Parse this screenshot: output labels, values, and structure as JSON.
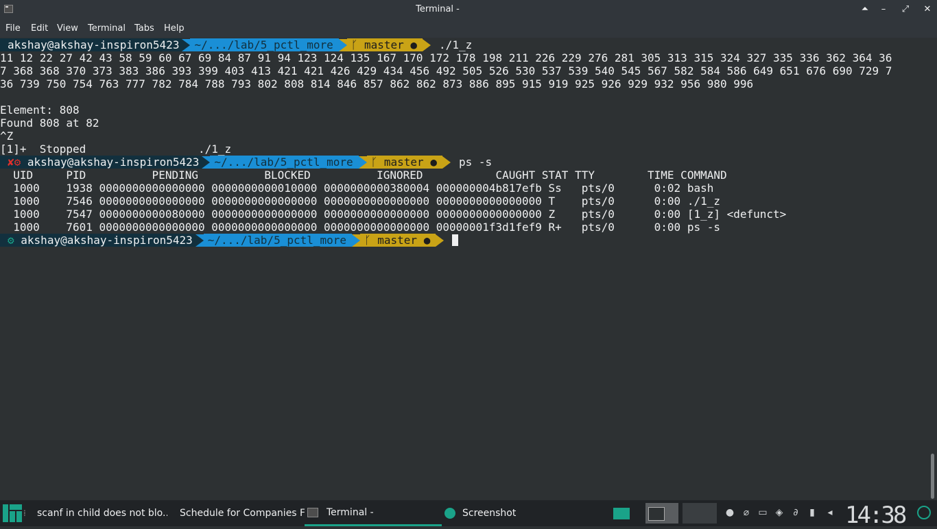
{
  "window": {
    "title": "Terminal -",
    "controls": [
      "⏶",
      "–",
      "⤢",
      "✕"
    ]
  },
  "menu": [
    "File",
    "Edit",
    "View",
    "Terminal",
    "Tabs",
    "Help"
  ],
  "prompt": {
    "user": "akshay@akshay-inspiron5423",
    "path": "~/.../lab/5_pctl_more",
    "git": "master ●",
    "git_icon": "git-branch-icon"
  },
  "lines": {
    "cmd1": "./1_z",
    "out1": "11 12 22 27 42 43 58 59 60 67 69 84 87 91 94 123 124 135 167 170 172 178 198 211 226 229 276 281 305 313 315 324 327 335 336 362 364 36",
    "out2": "7 368 368 370 373 383 386 393 399 403 413 421 421 426 429 434 456 492 505 526 530 537 539 540 545 567 582 584 586 649 651 676 690 729 7",
    "out3": "36 739 750 754 763 777 782 784 788 793 802 808 814 846 857 862 862 873 886 895 915 919 925 926 929 932 956 980 996",
    "element": "Element: 808",
    "found": "Found 808 at 82",
    "ctrlz": "^Z",
    "stopped": "[1]+  Stopped                 ./1_z",
    "cmd2": "ps -s",
    "status_fail": "✘⚙",
    "status_ok": "⚙"
  },
  "ps_header": "  UID     PID          PENDING          BLOCKED          IGNORED           CAUGHT STAT TTY        TIME COMMAND",
  "ps_rows": [
    "  1000    1938 0000000000000000 0000000000010000 0000000000380004 000000004b817efb Ss   pts/0      0:02 bash",
    "  1000    7546 0000000000000000 0000000000000000 0000000000000000 0000000000000000 T    pts/0      0:00 ./1_z",
    "  1000    7547 0000000000080000 0000000000000000 0000000000000000 0000000000000000 Z    pts/0      0:00 [1_z] <defunct>",
    "  1000    7601 0000000000000000 0000000000000000 0000000000000000 00000001f3d1fef9 R+   pts/0      0:00 ps -s"
  ],
  "taskbar": {
    "items": [
      {
        "label": "scanf in child does not blo...",
        "icon": "firefox-icon"
      },
      {
        "label": "Schedule for Companies F...",
        "icon": "spreadsheet-icon"
      },
      {
        "label": "Terminal -",
        "icon": "terminal-icon"
      },
      {
        "label": "Screenshot",
        "icon": "screenshot-icon"
      }
    ],
    "clock": "14:38"
  },
  "colors": {
    "user_bg": "#12303e",
    "path_bg": "#1a8fd6",
    "git_bg": "#c9a316",
    "error": "#e0302b",
    "ok_gear": "#1aa389"
  }
}
